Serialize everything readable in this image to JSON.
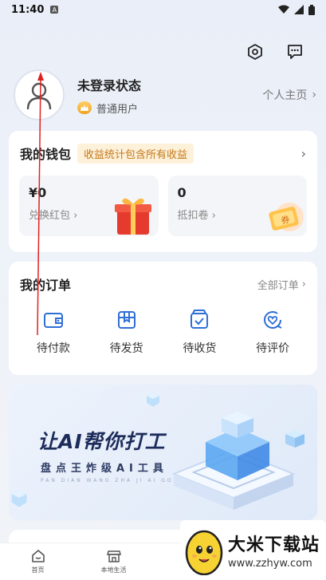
{
  "status_bar": {
    "time": "11:40",
    "sim_label": "A"
  },
  "profile": {
    "name": "未登录状态",
    "level": "普通用户",
    "homepage_link": "个人主页"
  },
  "wallet": {
    "title": "我的钱包",
    "promo": "收益统计包含所有收益",
    "boxes": [
      {
        "amount": "¥0",
        "label": "兑换红包"
      },
      {
        "amount": "0",
        "label": "抵扣卷"
      }
    ],
    "coupon_art_text": "券"
  },
  "orders": {
    "title": "我的订单",
    "all_link": "全部订单",
    "items": [
      {
        "label": "待付款",
        "icon": "wallet-icon"
      },
      {
        "label": "待发货",
        "icon": "package-icon"
      },
      {
        "label": "待收货",
        "icon": "box-check-icon"
      },
      {
        "label": "待评价",
        "icon": "heart-review-icon"
      }
    ]
  },
  "banner": {
    "headline": "让AI帮你打工",
    "subline": "盘点王炸级AI工具",
    "pinyin": "PAN DIAN WANG ZHA JI AI GONG JU"
  },
  "tabbar": {
    "tabs": [
      {
        "label": "首页",
        "icon": "home-icon"
      },
      {
        "label": "本地生活",
        "icon": "store-icon"
      }
    ]
  },
  "watermark": {
    "title": "大米下载站",
    "url": "www.zzhyw.com"
  },
  "colors": {
    "accent": "#2f6fd6",
    "promo_text": "#c4781a",
    "promo_bg": "#fdf1d9",
    "annotation_red": "#e02020"
  }
}
